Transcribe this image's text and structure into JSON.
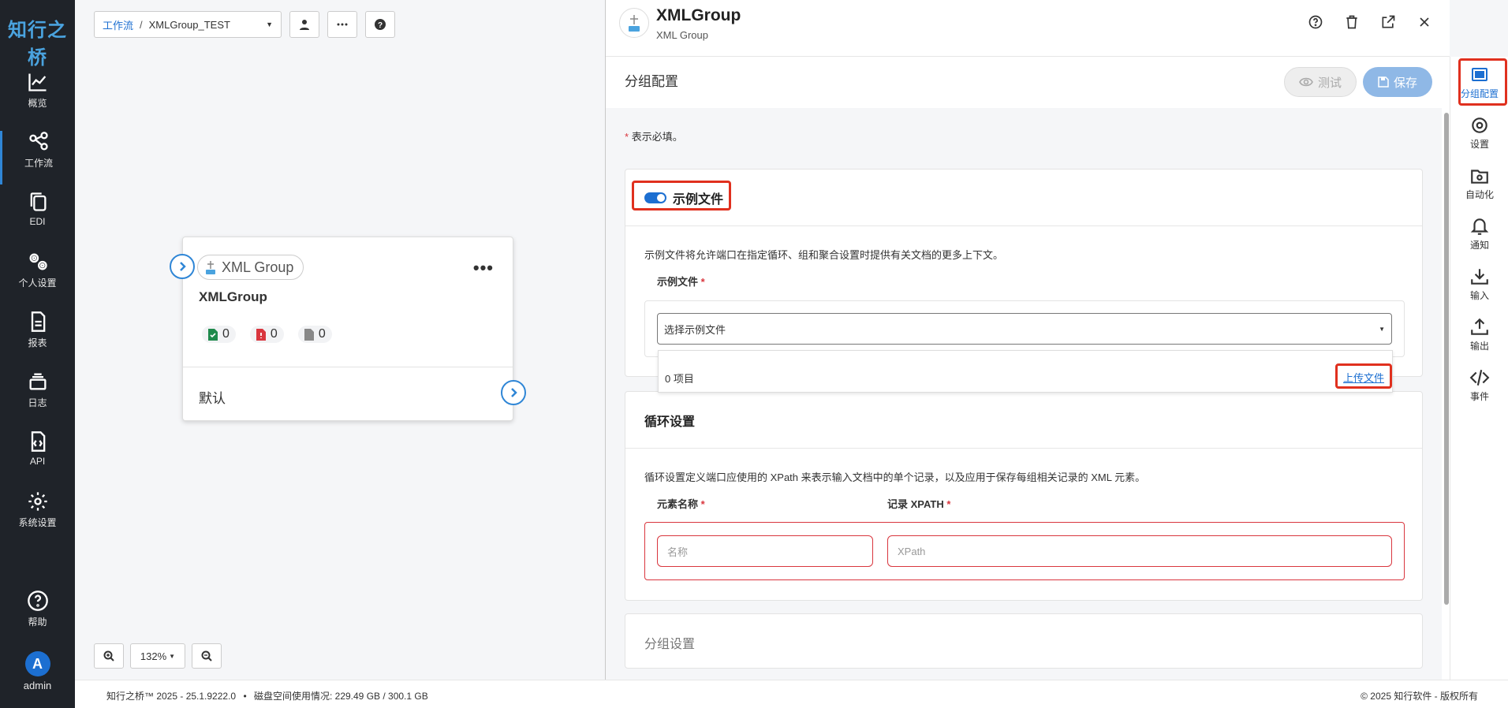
{
  "app": {
    "logo_text": "知行之桥"
  },
  "nav": {
    "items": [
      {
        "label": "概览",
        "icon": "chart-line-icon"
      },
      {
        "label": "工作流",
        "icon": "share-nodes-icon"
      },
      {
        "label": "EDI",
        "icon": "copy-icon"
      },
      {
        "label": "个人设置",
        "icon": "gears-icon"
      },
      {
        "label": "报表",
        "icon": "file-icon"
      },
      {
        "label": "日志",
        "icon": "layers-icon"
      },
      {
        "label": "API",
        "icon": "file-code-icon"
      },
      {
        "label": "系统设置",
        "icon": "gear-icon"
      }
    ],
    "help_label": "帮助",
    "user_initial": "A",
    "user_name": "admin"
  },
  "canvas": {
    "breadcrumb_root": "工作流",
    "breadcrumb_sep": "/",
    "breadcrumb_current": "XMLGroup_TEST",
    "zoom": "132%",
    "node": {
      "type_label": "XML Group",
      "name": "XMLGroup",
      "count_success": "0",
      "count_error": "0",
      "count_pending": "0",
      "output_label": "默认"
    }
  },
  "panel": {
    "title": "XMLGroup",
    "subtitle": "XML Group",
    "section_title": "分组配置",
    "test_label": "测试",
    "save_label": "保存",
    "required_star": "*",
    "required_note": "表示必填。",
    "sample": {
      "title": "示例文件",
      "desc": "示例文件将允许端口在指定循环、组和聚合设置时提供有关文档的更多上下文。",
      "field_label": "示例文件",
      "select_placeholder": "选择示例文件",
      "items_count": "0 项目",
      "upload_link": "上传文件"
    },
    "loop": {
      "title": "循环设置",
      "desc": "循环设置定义端口应使用的 XPath 来表示输入文档中的单个记录，以及应用于保存每组相关记录的 XML 元素。",
      "element_label": "元素名称",
      "xpath_label": "记录 XPATH",
      "name_placeholder": "名称",
      "xpath_placeholder": "XPath"
    },
    "group": {
      "title": "分组设置"
    }
  },
  "rail": {
    "items": [
      {
        "label": "分组配置",
        "icon": "image-config-icon"
      },
      {
        "label": "设置",
        "icon": "gear-icon"
      },
      {
        "label": "自动化",
        "icon": "folder-gear-icon"
      },
      {
        "label": "通知",
        "icon": "bell-icon"
      },
      {
        "label": "输入",
        "icon": "download-icon"
      },
      {
        "label": "输出",
        "icon": "upload-icon"
      },
      {
        "label": "事件",
        "icon": "code-icon"
      }
    ]
  },
  "footer": {
    "version": "知行之桥™ 2025 - 25.1.9222.0",
    "bullet": "•",
    "disk": "磁盘空间使用情况:   229.49 GB / 300.1 GB",
    "copyright": "© 2025 知行软件 - 版权所有"
  },
  "colors": {
    "accent": "#1c6fd1",
    "nav_bg": "#1f2329",
    "highlight": "#e0301e",
    "error": "#d9363e",
    "success": "#1f8a4c"
  }
}
